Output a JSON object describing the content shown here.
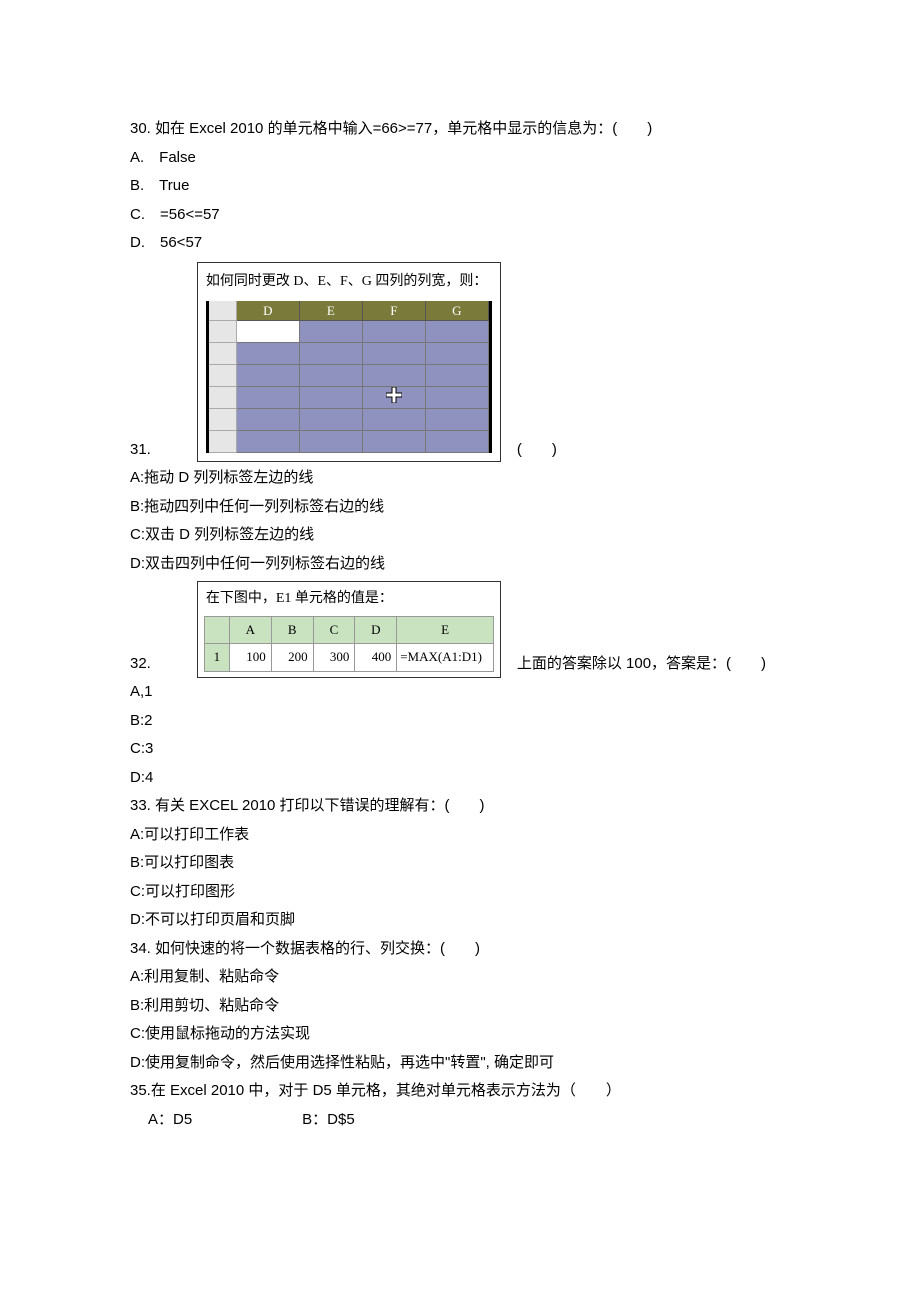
{
  "q30": {
    "stem": "30.  如在 Excel 2010 的单元格中输入=66>=77，单元格中显示的信息为：(　　)",
    "a": "A.　False",
    "b": "B.　True",
    "c": "C.　=56<=57",
    "d": "D.　56<57"
  },
  "fig1": {
    "caption": "如何同时更改 D、E、F、G 四列的列宽，则：",
    "cols": [
      "D",
      "E",
      "F",
      "G"
    ]
  },
  "q31": {
    "num": "31.",
    "bracket": "(　　)",
    "a": "A:拖动 D 列列标签左边的线",
    "b": "B:拖动四列中任何一列列标签右边的线",
    "c": "C:双击 D 列列标签左边的线",
    "d": "D:双击四列中任何一列列标签右边的线"
  },
  "fig2": {
    "caption": "在下图中，E1 单元格的值是：",
    "cols": [
      "A",
      "B",
      "C",
      "D",
      "E"
    ],
    "rowh": "1",
    "vals": [
      "100",
      "200",
      "300",
      "400",
      "=MAX(A1:D1)"
    ]
  },
  "q32": {
    "num": "32.",
    "tail": "上面的答案除以 100，答案是：(　　)",
    "a": "A,1",
    "b": "B:2",
    "c": "C:3",
    "d": "D:4"
  },
  "q33": {
    "stem": "33.  有关 EXCEL 2010 打印以下错误的理解有：(　　)",
    "a": "A:可以打印工作表",
    "b": "B:可以打印图表",
    "c": "C:可以打印图形",
    "d": "D:不可以打印页眉和页脚"
  },
  "q34": {
    "stem": "34.  如何快速的将一个数据表格的行、列交换：(　　)",
    "a": "A:利用复制、粘贴命令",
    "b": "B:利用剪切、粘贴命令",
    "c": "C:使用鼠标拖动的方法实现",
    "d": "D:使用复制命令，然后使用选择性粘贴，再选中\"转置\", 确定即可"
  },
  "q35": {
    "stem": "35.在 Excel 2010 中，对于 D5 单元格，其绝对单元格表示方法为（　　）",
    "a": "A：D5",
    "b": "B：D$5"
  }
}
